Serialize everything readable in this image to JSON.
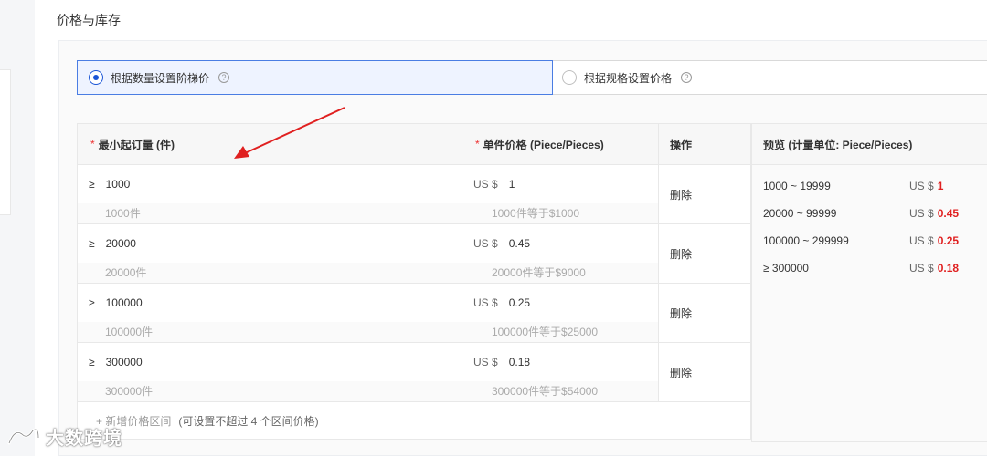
{
  "section_title": "价格与库存",
  "pricing_mode": {
    "option1_label": "根据数量设置阶梯价",
    "option2_label": "根据规格设置价格",
    "help_glyph": "?"
  },
  "table": {
    "col_min_qty": "最小起订量 (件)",
    "col_unit_price": "单件价格 (Piece/Pieces)",
    "col_action": "操作",
    "required_mark": "*",
    "ge_symbol": "≥",
    "currency": "US $",
    "delete_label": "删除",
    "rows": [
      {
        "qty": "1000",
        "qty_note": "1000件",
        "price": "1",
        "price_note": "1000件等于$1000"
      },
      {
        "qty": "20000",
        "qty_note": "20000件",
        "price": "0.45",
        "price_note": "20000件等于$9000"
      },
      {
        "qty": "100000",
        "qty_note": "100000件",
        "price": "0.25",
        "price_note": "100000件等于$25000"
      },
      {
        "qty": "300000",
        "qty_note": "300000件",
        "price": "0.18",
        "price_note": "300000件等于$54000"
      }
    ],
    "add_label": "+ 新增价格区间",
    "add_hint": "(可设置不超过 4 个区间价格)"
  },
  "preview": {
    "title": "预览 (计量单位: Piece/Pieces)",
    "currency": "US $",
    "rows": [
      {
        "range": "1000 ~ 19999",
        "price": "1"
      },
      {
        "range": "20000 ~ 99999",
        "price": "0.45"
      },
      {
        "range": "100000 ~ 299999",
        "price": "0.25"
      },
      {
        "range": "≥ 300000",
        "price": "0.18"
      }
    ]
  },
  "watermark": "大数跨境",
  "colors": {
    "accent": "#1a55d6",
    "price_highlight": "#e02020",
    "arrow": "#e02020"
  }
}
